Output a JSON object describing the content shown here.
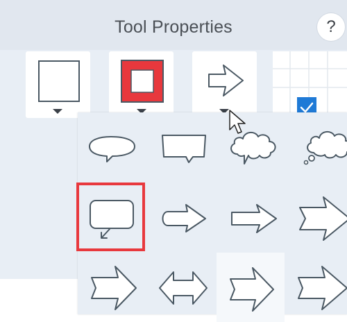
{
  "window": {
    "title": "Tool Properties",
    "help_label": "?"
  },
  "toolbar": {
    "fill_color": "#ffffff",
    "outline_color": "#e8383d",
    "shape_preview": "arrow-icon",
    "grid_checked_cell": "checkmark-icon"
  },
  "shapes_popup": {
    "items": [
      {
        "name": "speech-bubble-rounded-icon"
      },
      {
        "name": "speech-bubble-rect-icon"
      },
      {
        "name": "cloud-callout-icon"
      },
      {
        "name": "thought-bubble-icon"
      },
      {
        "name": "callout-box-arrow-icon",
        "selected": true
      },
      {
        "name": "rounded-arrow-icon"
      },
      {
        "name": "right-arrow-icon"
      },
      {
        "name": "notched-arrow-icon"
      },
      {
        "name": "notched-arrow-large-icon"
      },
      {
        "name": "double-arrow-icon"
      },
      {
        "name": "notched-arrow-hover-icon",
        "hovered": true
      },
      {
        "name": "notched-arrow-partial-icon"
      }
    ]
  },
  "colors": {
    "accent": "#e8383d",
    "stroke": "#4a5863",
    "check": "#1f7ad6"
  }
}
